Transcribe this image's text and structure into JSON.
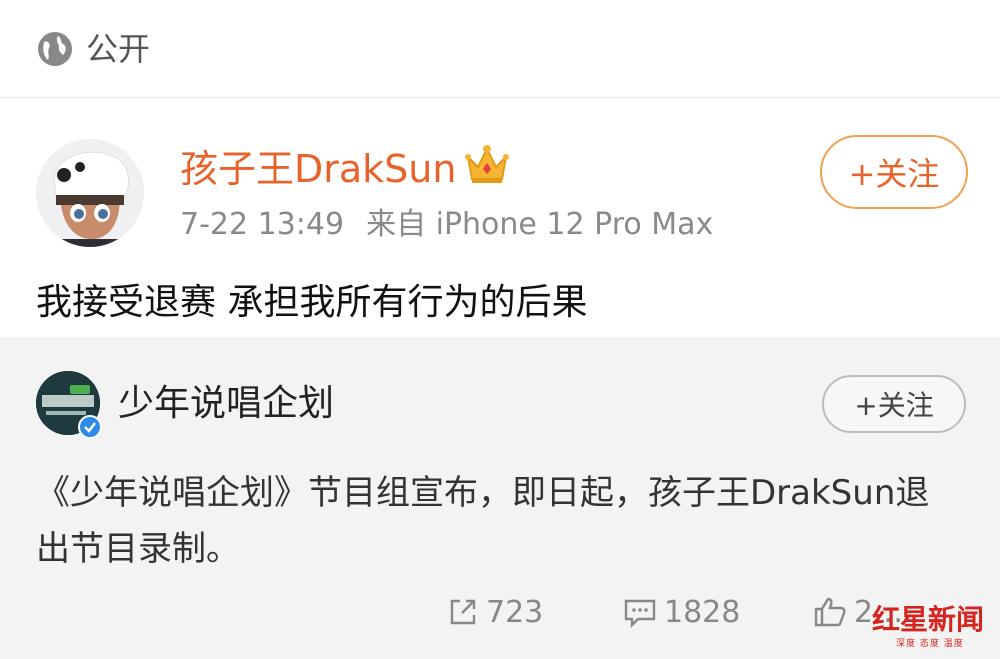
{
  "visibility": {
    "icon": "globe-icon",
    "label": "公开"
  },
  "post": {
    "author": "孩子王DrakSun",
    "badge": "crown-icon",
    "time": "7-22 13:49",
    "source": "来自 iPhone 12 Pro Max",
    "follow_label": "+关注",
    "text": "我接受退赛 承担我所有行为的后果"
  },
  "repost": {
    "author": "少年说唱企划",
    "verified": "verified-badge-icon",
    "follow_label": "+关注",
    "text": "《少年说唱企划》节目组宣布，即日起，孩子王DrakSun退出节目录制。",
    "actions": {
      "share_count": "723",
      "comment_count": "1828",
      "like_count": "2…"
    }
  },
  "watermark": {
    "logo": "红星新闻",
    "subtitle": "深度 态度 温度"
  },
  "colors": {
    "accent": "#e8632b",
    "follow_border": "#f0a050",
    "repost_bg": "#f3f3f3",
    "meta": "#8a8a8a"
  }
}
